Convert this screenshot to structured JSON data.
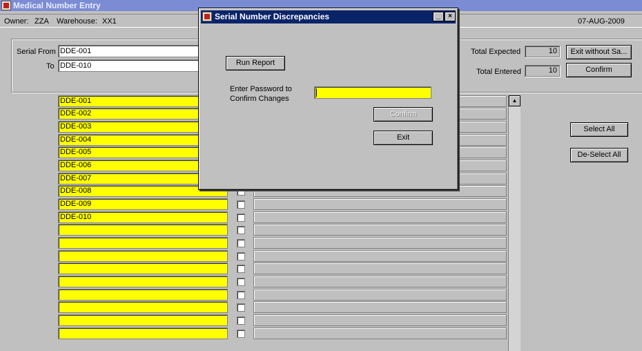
{
  "window": {
    "title": "Medical Number Entry"
  },
  "info": {
    "owner_label": "Owner:",
    "owner_value": "ZZA",
    "warehouse_label": "Warehouse:",
    "warehouse_value": "XX1",
    "date": "07-AUG-2009"
  },
  "header": {
    "serial_from_label": "Serial From",
    "serial_from_value": "DDE-001",
    "to_label": "To",
    "to_value": "DDE-010",
    "total_expected_label": "Total Expected",
    "total_expected_value": "10",
    "total_entered_label": "Total Entered",
    "total_entered_value": "10",
    "exit_without_save_label": "Exit without Sa...",
    "confirm_label": "Confirm"
  },
  "side_buttons": {
    "select_all": "Select All",
    "deselect_all": "De-Select All"
  },
  "rows": [
    {
      "serial": "DDE-001"
    },
    {
      "serial": "DDE-002"
    },
    {
      "serial": "DDE-003"
    },
    {
      "serial": "DDE-004"
    },
    {
      "serial": "DDE-005"
    },
    {
      "serial": "DDE-006"
    },
    {
      "serial": "DDE-007"
    },
    {
      "serial": "DDE-008"
    },
    {
      "serial": "DDE-009"
    },
    {
      "serial": "DDE-010"
    },
    {
      "serial": ""
    },
    {
      "serial": ""
    },
    {
      "serial": ""
    },
    {
      "serial": ""
    },
    {
      "serial": ""
    },
    {
      "serial": ""
    },
    {
      "serial": ""
    },
    {
      "serial": ""
    },
    {
      "serial": ""
    }
  ],
  "dialog": {
    "title": "Serial Number Discrepancies",
    "run_report": "Run Report",
    "password_label_line1": "Enter Password to",
    "password_label_line2": "Confirm Changes",
    "password_value": "",
    "confirm": "Confirm",
    "exit": "Exit",
    "minimize": "_",
    "close": "×"
  },
  "colors": {
    "field_yellow": "#ffff00",
    "dialog_title": "#0a246a",
    "window_title": "#7b8bd4"
  }
}
